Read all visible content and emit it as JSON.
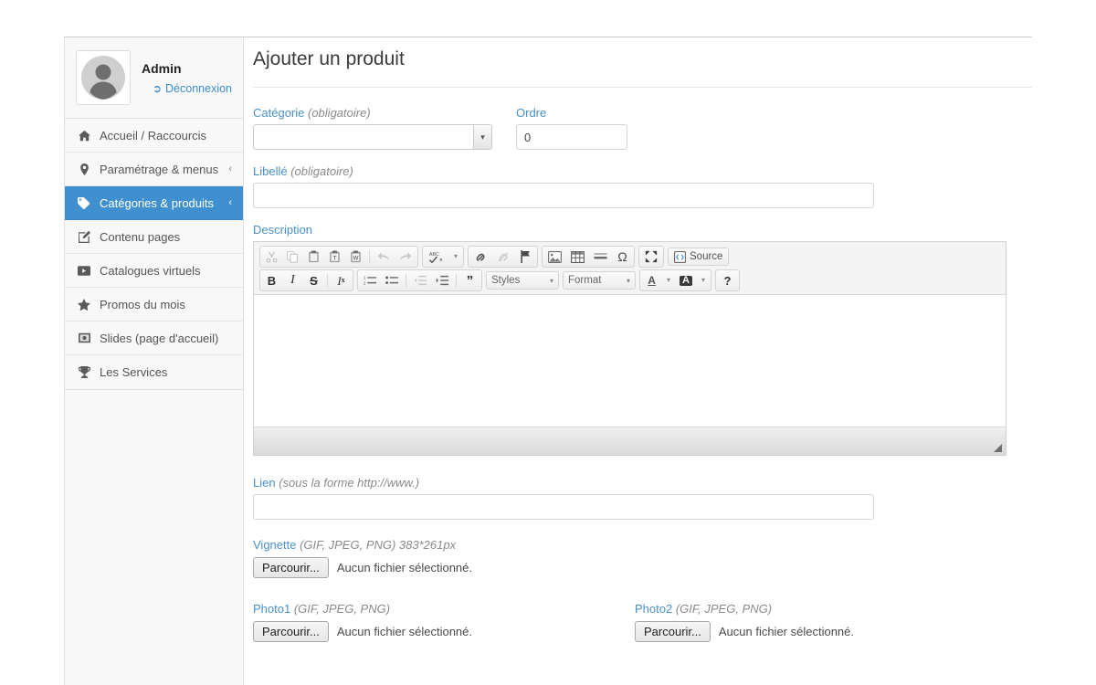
{
  "sidebar": {
    "user": {
      "name": "Admin",
      "logout_label": "Déconnexion",
      "logout_icon": "sign-out-icon",
      "avatar_icon": "user-avatar-icon"
    },
    "items": [
      {
        "label": "Accueil / Raccourcis",
        "icon": "home-icon",
        "caret": "",
        "active": false
      },
      {
        "label": "Paramétrage & menus",
        "icon": "map-marker-icon",
        "caret": "‹",
        "active": false
      },
      {
        "label": "Catégories & produits",
        "icon": "tag-icon",
        "caret": "‹",
        "active": true
      },
      {
        "label": "Contenu pages",
        "icon": "edit-pencil-icon",
        "caret": "",
        "active": false
      },
      {
        "label": "Catalogues virtuels",
        "icon": "video-play-icon",
        "caret": "",
        "active": false
      },
      {
        "label": "Promos du mois",
        "icon": "star-icon",
        "caret": "",
        "active": false
      },
      {
        "label": "Slides (page d'accueil)",
        "icon": "image-frame-icon",
        "caret": "",
        "active": false
      },
      {
        "label": "Les Services",
        "icon": "trophy-icon",
        "caret": "",
        "active": false
      }
    ]
  },
  "main": {
    "title": "Ajouter un produit",
    "fields": {
      "categorie": {
        "label": "Catégorie",
        "hint": "(obligatoire)",
        "value": "",
        "icon": "chevron-down-icon"
      },
      "ordre": {
        "label": "Ordre",
        "hint": "",
        "value": "0"
      },
      "libelle": {
        "label": "Libellé",
        "hint": "(obligatoire)",
        "value": ""
      },
      "description": {
        "label": "Description",
        "hint": "",
        "value": ""
      },
      "lien": {
        "label": "Lien",
        "hint": "(sous la forme http://www.)",
        "value": ""
      },
      "vignette": {
        "label": "Vignette",
        "hint": "(GIF, JPEG, PNG) 383*261px",
        "browse_label": "Parcourir...",
        "file_status": "Aucun fichier sélectionné."
      },
      "photo1": {
        "label": "Photo1",
        "hint": "(GIF, JPEG, PNG)",
        "browse_label": "Parcourir...",
        "file_status": "Aucun fichier sélectionné."
      },
      "photo2": {
        "label": "Photo2",
        "hint": "(GIF, JPEG, PNG)",
        "browse_label": "Parcourir...",
        "file_status": "Aucun fichier sélectionné."
      }
    }
  },
  "editor": {
    "toolbar_row1": [
      {
        "name": "cut-icon",
        "glyph": "✂",
        "disabled": true
      },
      {
        "name": "copy-icon",
        "glyph": "❐",
        "disabled": true
      },
      {
        "name": "paste-icon",
        "glyph": "ὌB",
        "disabled": false
      },
      {
        "name": "paste-as-plain-text-icon",
        "glyph": "T",
        "disabled": false
      },
      {
        "name": "paste-from-word-icon",
        "glyph": "W",
        "disabled": false
      },
      {
        "name": "undo-icon",
        "glyph": "↶",
        "disabled": true
      },
      {
        "name": "redo-icon",
        "glyph": "↷",
        "disabled": true
      },
      {
        "name": "spellcheck-icon",
        "glyph": "ABC",
        "disabled": false
      },
      {
        "name": "link-icon",
        "glyph": "ὑ7",
        "disabled": false
      },
      {
        "name": "unlink-icon",
        "glyph": "ὑ7",
        "disabled": true
      },
      {
        "name": "anchor-flag-icon",
        "glyph": "⚑",
        "disabled": false
      },
      {
        "name": "insert-image-icon",
        "glyph": "ὛC",
        "disabled": false
      },
      {
        "name": "insert-table-icon",
        "glyph": "▦",
        "disabled": false
      },
      {
        "name": "horizontal-rule-icon",
        "glyph": "≡",
        "disabled": false
      },
      {
        "name": "special-character-icon",
        "glyph": "Ω",
        "disabled": false
      },
      {
        "name": "maximize-icon",
        "glyph": "⤢",
        "disabled": false
      }
    ],
    "source_label": "Source",
    "source_icon": "source-code-icon",
    "toolbar_row2": [
      {
        "name": "bold-icon",
        "glyph": "B"
      },
      {
        "name": "italic-icon",
        "glyph": "I"
      },
      {
        "name": "strikethrough-icon",
        "glyph": "S"
      },
      {
        "name": "remove-format-icon",
        "glyph": "Ix"
      },
      {
        "name": "numbered-list-icon",
        "glyph": "1≡"
      },
      {
        "name": "bulleted-list-icon",
        "glyph": "•≡"
      },
      {
        "name": "decrease-indent-icon",
        "glyph": "⇤"
      },
      {
        "name": "increase-indent-icon",
        "glyph": "⇥"
      },
      {
        "name": "blockquote-icon",
        "glyph": "”"
      }
    ],
    "styles_label": "Styles",
    "format_label": "Format",
    "text_color_icon": "text-color-icon",
    "bg_color_icon": "background-color-icon",
    "help_label": "?",
    "content": ""
  },
  "colors": {
    "accent": "#4090d0",
    "label_blue": "#4a90c8",
    "sidebar_bg": "#f8f8f8",
    "border": "#e0e0e0",
    "text": "#333333"
  }
}
